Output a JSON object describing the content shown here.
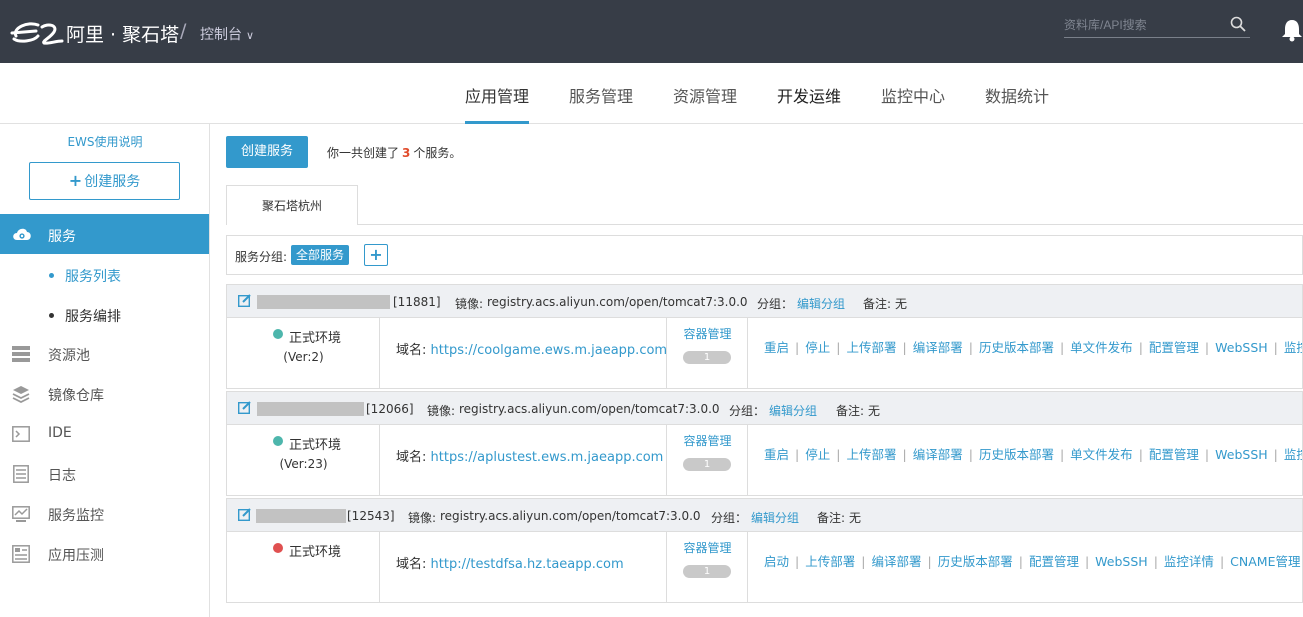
{
  "topbar": {
    "brand": "阿里 · 聚石塔",
    "separator": "/",
    "console": "控制台",
    "search_placeholder": "资料库/API搜索"
  },
  "mainnav": [
    {
      "label": "应用管理",
      "active": true
    },
    {
      "label": "服务管理"
    },
    {
      "label": "资源管理"
    },
    {
      "label": "开发运维"
    },
    {
      "label": "监控中心"
    },
    {
      "label": "数据统计"
    }
  ],
  "sidebar": {
    "help_link": "EWS使用说明",
    "create_plus": "+",
    "create_label": "创建服务",
    "active_item": "服务",
    "sub_items": [
      "服务列表",
      "服务编排"
    ],
    "items": [
      "资源池",
      "镜像仓库",
      "IDE",
      "日志",
      "服务监控",
      "应用压测"
    ]
  },
  "content": {
    "create_button": "创建服务",
    "summary_pre": "你一共创建了",
    "summary_count": "3",
    "summary_post": "个服务。",
    "region_tab": "聚石塔杭州",
    "group_label": "服务分组:",
    "group_tag": "全部服务",
    "group_add": "+"
  },
  "services": [
    {
      "id": "[11881]",
      "image_label": "镜像:",
      "image": "registry.acs.aliyun.com/open/tomcat7:3.0.0",
      "group_label": "分组：",
      "group_link": "编辑分组",
      "note_label": "备注:",
      "note": "无",
      "env_status": "正式环境",
      "env_color": "#4db6ac",
      "version": "(Ver:2)",
      "domain_label": "域名:",
      "domain": "https://coolgame.ews.m.jaeapp.com",
      "container_label": "容器管理",
      "container_count": "1",
      "actions": [
        "重启",
        "停止",
        "上传部署",
        "编译部署",
        "历史版本部署",
        "单文件发布",
        "配置管理",
        "WebSSH",
        "监控详情"
      ]
    },
    {
      "id": "[12066]",
      "image_label": "镜像:",
      "image": "registry.acs.aliyun.com/open/tomcat7:3.0.0",
      "group_label": "分组：",
      "group_link": "编辑分组",
      "note_label": "备注:",
      "note": "无",
      "env_status": "正式环境",
      "env_color": "#4db6ac",
      "version": "(Ver:23)",
      "domain_label": "域名:",
      "domain": "https://aplustest.ews.m.jaeapp.com",
      "container_label": "容器管理",
      "container_count": "1",
      "actions": [
        "重启",
        "停止",
        "上传部署",
        "编译部署",
        "历史版本部署",
        "单文件发布",
        "配置管理",
        "WebSSH",
        "监控详情"
      ]
    },
    {
      "id": "[12543]",
      "image_label": "镜像:",
      "image": "registry.acs.aliyun.com/open/tomcat7:3.0.0",
      "group_label": "分组：",
      "group_link": "编辑分组",
      "note_label": "备注:",
      "note": "无",
      "env_status": "正式环境",
      "env_color": "#e05050",
      "version": "",
      "domain_label": "域名:",
      "domain": "http://testdfsa.hz.taeapp.com",
      "container_label": "容器管理",
      "container_count": "1",
      "actions": [
        "启动",
        "上传部署",
        "编译部署",
        "历史版本部署",
        "配置管理",
        "WebSSH",
        "监控详情",
        "CNAME管理"
      ]
    }
  ],
  "colors": {
    "accent": "#3399cc",
    "topbar": "#373d47",
    "count_red": "#e14c2c"
  }
}
